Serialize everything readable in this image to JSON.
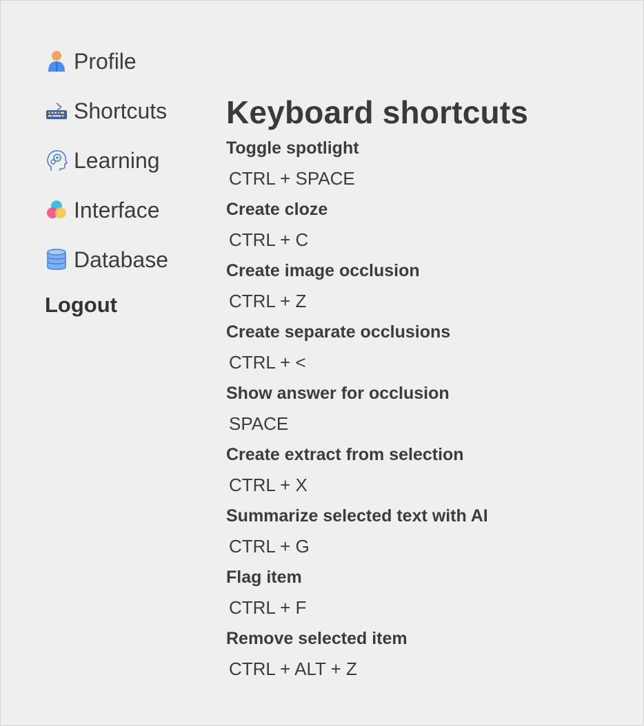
{
  "sidebar": {
    "items": [
      {
        "label": "Profile",
        "icon": "person-icon"
      },
      {
        "label": "Shortcuts",
        "icon": "keyboard-icon"
      },
      {
        "label": "Learning",
        "icon": "brain-gear-icon"
      },
      {
        "label": "Interface",
        "icon": "color-circles-icon"
      },
      {
        "label": "Database",
        "icon": "database-icon"
      }
    ],
    "logout_label": "Logout"
  },
  "main": {
    "title": "Keyboard shortcuts",
    "shortcuts": [
      {
        "label": "Toggle spotlight",
        "keys": "CTRL + SPACE"
      },
      {
        "label": "Create cloze",
        "keys": "CTRL + C"
      },
      {
        "label": "Create image occlusion",
        "keys": "CTRL + Z"
      },
      {
        "label": "Create separate occlusions",
        "keys": "CTRL + <"
      },
      {
        "label": "Show answer for occlusion",
        "keys": "SPACE"
      },
      {
        "label": "Create extract from selection",
        "keys": "CTRL + X"
      },
      {
        "label": "Summarize selected text with AI",
        "keys": "CTRL + G"
      },
      {
        "label": "Flag item",
        "keys": "CTRL + F"
      },
      {
        "label": "Remove selected item",
        "keys": "CTRL + ALT + Z"
      }
    ]
  },
  "colors": {
    "background": "#efefef",
    "text": "#3c3c3c",
    "accent_blue": "#4a8ef0",
    "accent_orange": "#f4a261"
  }
}
